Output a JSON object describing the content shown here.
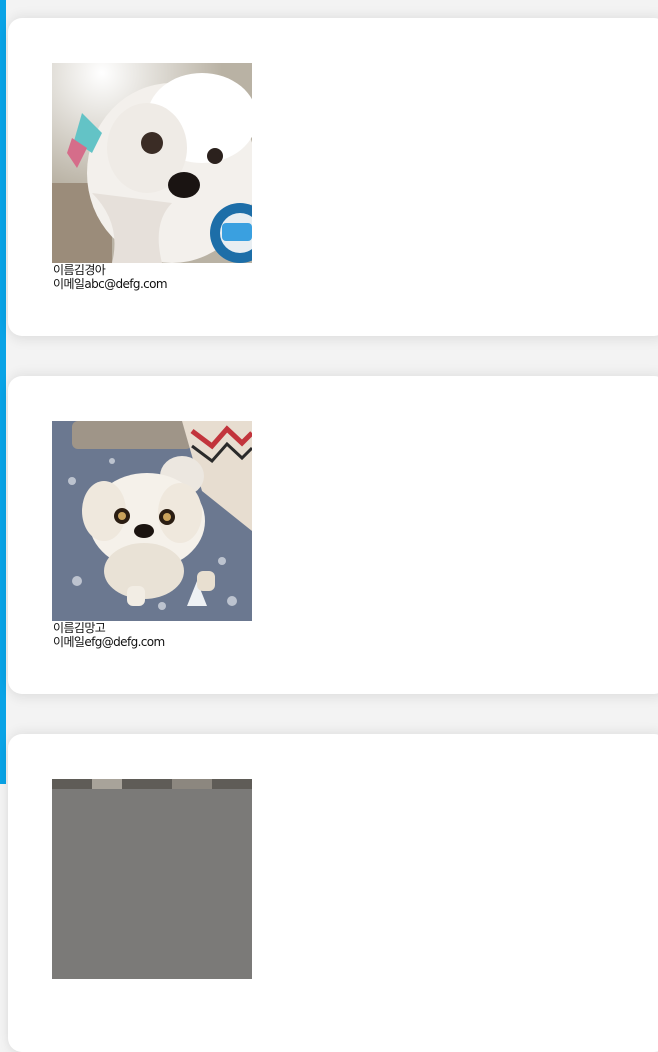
{
  "users": [
    {
      "name_label": "이름",
      "name": "김경아",
      "email_label": "이메일",
      "email": "abc@defg.com"
    },
    {
      "name_label": "이름",
      "name": "김망고",
      "email_label": "이메일",
      "email": "efg@defg.com"
    }
  ],
  "colors": {
    "accent_bar": "#0aa3e6",
    "card_bg": "#ffffff",
    "page_bg": "#f3f3f3"
  }
}
